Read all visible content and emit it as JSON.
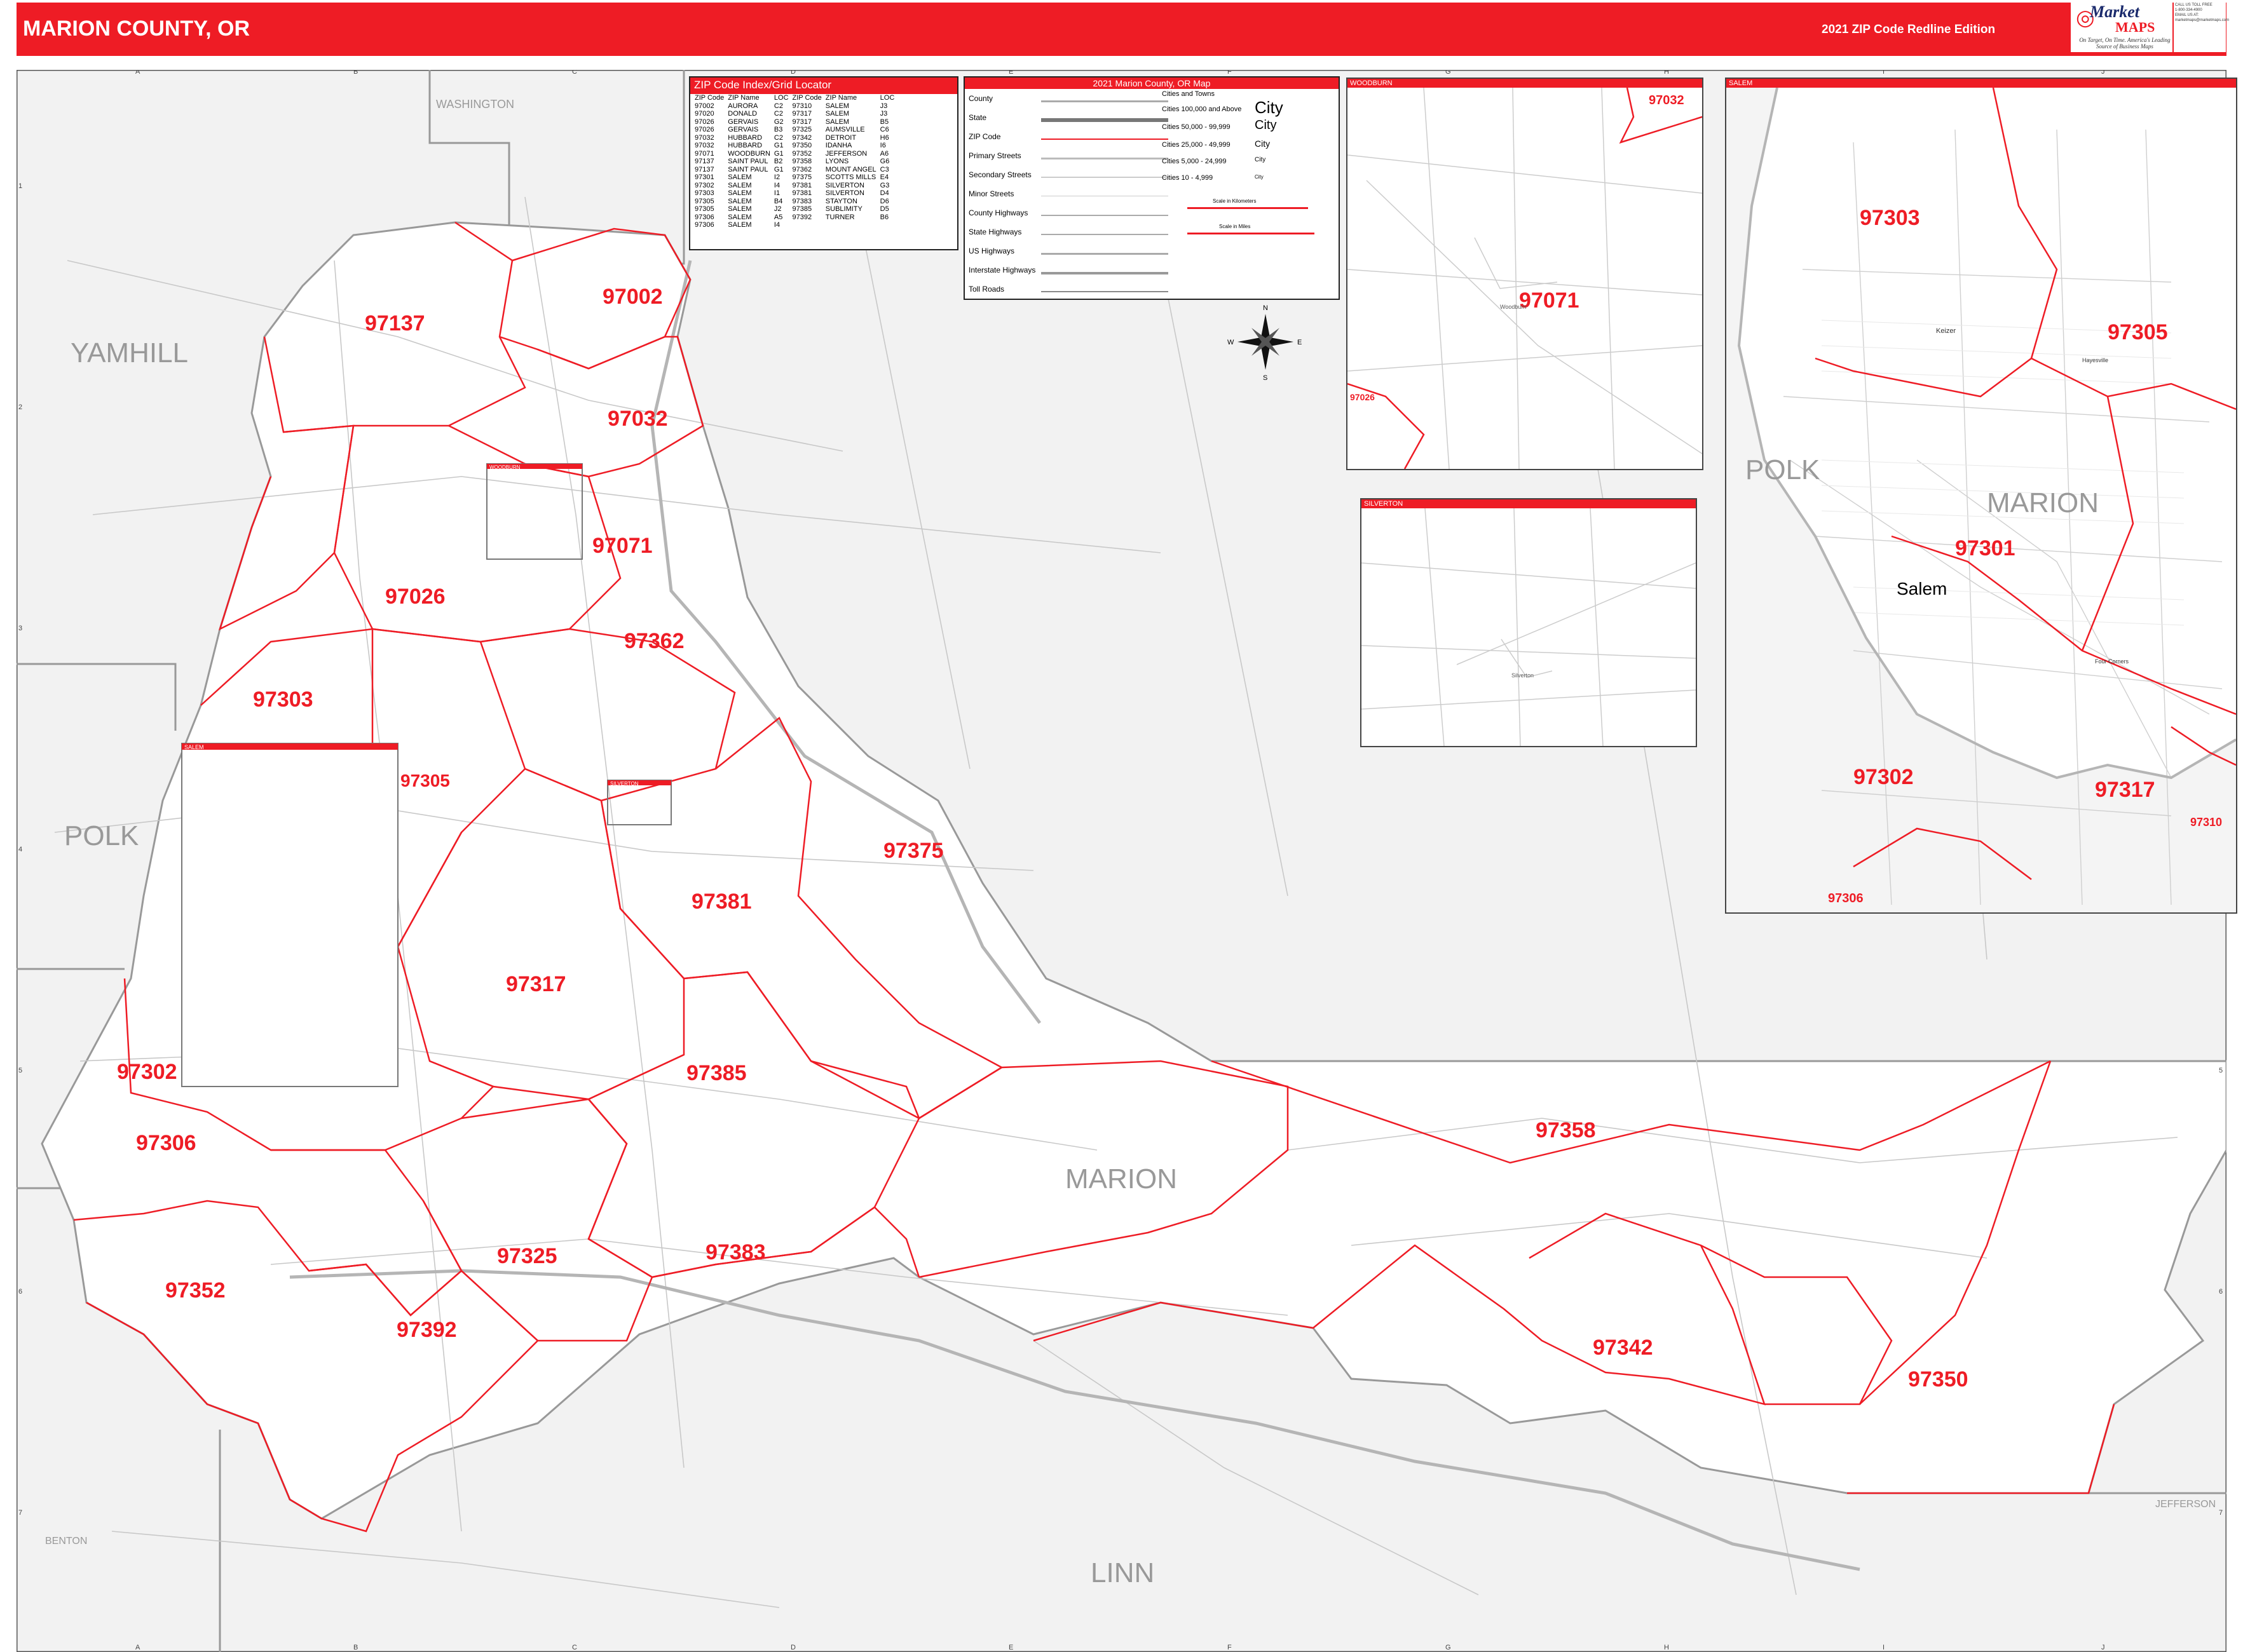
{
  "header": {
    "title": "MARION COUNTY, OR",
    "edition": "2021 ZIP Code Redline Edition",
    "logo_brand_top": "Market",
    "logo_brand_bottom": "MAPS",
    "logo_tagline": "On Target, On Time. America's Leading Source of Business Maps",
    "contact_lines": [
      "CALL US TOLL FREE",
      "1-800-334-4900",
      "EMAIL US AT:",
      "marketmaps@marketmaps.com"
    ]
  },
  "grid": {
    "columns": [
      "A",
      "B",
      "C",
      "D",
      "E",
      "F",
      "G",
      "H",
      "I",
      "J"
    ],
    "rows": [
      "1",
      "2",
      "3",
      "4",
      "5",
      "6",
      "7"
    ]
  },
  "zip_index": {
    "title": "ZIP Code Index/Grid Locator",
    "headers": [
      "ZIP Code",
      "ZIP Name",
      "LOC",
      "ZIP Code",
      "ZIP Name",
      "LOC"
    ],
    "rows": [
      [
        "97002",
        "AURORA",
        "C2",
        "97310",
        "SALEM",
        "J3"
      ],
      [
        "97020",
        "DONALD",
        "C2",
        "97317",
        "SALEM",
        "J3"
      ],
      [
        "97026",
        "GERVAIS",
        "G2",
        "97317",
        "SALEM",
        "B5"
      ],
      [
        "97026",
        "GERVAIS",
        "B3",
        "97325",
        "AUMSVILLE",
        "C6"
      ],
      [
        "97032",
        "HUBBARD",
        "C2",
        "97342",
        "DETROIT",
        "H6"
      ],
      [
        "97032",
        "HUBBARD",
        "G1",
        "97350",
        "IDANHA",
        "I6"
      ],
      [
        "97071",
        "WOODBURN",
        "G1",
        "97352",
        "JEFFERSON",
        "A6"
      ],
      [
        "97137",
        "SAINT PAUL",
        "B2",
        "97358",
        "LYONS",
        "G6"
      ],
      [
        "97137",
        "SAINT PAUL",
        "G1",
        "97362",
        "MOUNT ANGEL",
        "C3"
      ],
      [
        "97301",
        "SALEM",
        "I2",
        "97375",
        "SCOTTS MILLS",
        "E4"
      ],
      [
        "97302",
        "SALEM",
        "I4",
        "97381",
        "SILVERTON",
        "G3"
      ],
      [
        "97303",
        "SALEM",
        "I1",
        "97381",
        "SILVERTON",
        "D4"
      ],
      [
        "97305",
        "SALEM",
        "B4",
        "97383",
        "STAYTON",
        "D6"
      ],
      [
        "97305",
        "SALEM",
        "J2",
        "97385",
        "SUBLIMITY",
        "D5"
      ],
      [
        "97306",
        "SALEM",
        "A5",
        "97392",
        "TURNER",
        "B6"
      ],
      [
        "97306",
        "SALEM",
        "I4",
        "",
        "",
        ""
      ]
    ]
  },
  "legend": {
    "title": "2021 Marion County, OR Map",
    "items": [
      "County",
      "State",
      "ZIP Code",
      "Primary Streets",
      "Secondary Streets",
      "Minor Streets",
      "County Highways",
      "State Highways",
      "US Highways",
      "Interstate Highways",
      "Toll Roads"
    ],
    "city_heading": "Cities and Towns",
    "city_classes": [
      {
        "label": "Cities 100,000 and Above",
        "sample": "City"
      },
      {
        "label": "Cities 50,000 - 99,999",
        "sample": "City"
      },
      {
        "label": "Cities 25,000 - 49,999",
        "sample": "City"
      },
      {
        "label": "Cities 5,000 - 24,999",
        "sample": "City"
      },
      {
        "label": "Cities 10 - 4,999",
        "sample": "City"
      }
    ],
    "scale_km": "Scale in Kilometers",
    "scale_mi": "Scale in Miles"
  },
  "compass": {
    "n": "N",
    "s": "S",
    "e": "E",
    "w": "W"
  },
  "counties": [
    "WASHINGTON",
    "YAMHILL",
    "POLK",
    "MARION",
    "LINN",
    "BENTON",
    "JEFFERSON"
  ],
  "main_zips": [
    "97137",
    "97002",
    "97032",
    "97071",
    "97026",
    "97362",
    "97303",
    "97305",
    "97375",
    "97381",
    "97317",
    "97302",
    "97385",
    "97306",
    "97358",
    "97325",
    "97383",
    "97352",
    "97392",
    "97342",
    "97350"
  ],
  "inset_labels": {
    "woodburn": "WOODBURN",
    "silverton": "SILVERTON",
    "salem": "SALEM"
  },
  "woodburn_inset": {
    "zips": [
      "97032",
      "97071",
      "97026"
    ],
    "city": "Woodburn"
  },
  "silverton_inset": {
    "city": "Silverton"
  },
  "salem_inset": {
    "zips": [
      "97303",
      "97305",
      "97301",
      "97302",
      "97317",
      "97310",
      "97306"
    ],
    "counties": [
      "POLK",
      "MARION"
    ],
    "cities": [
      "Salem",
      "Keizer",
      "Four Corners",
      "Hayesville"
    ]
  },
  "colors": {
    "accent": "#ee1c25",
    "land": "#f2f2f2",
    "county_fill": "#ffffff"
  }
}
